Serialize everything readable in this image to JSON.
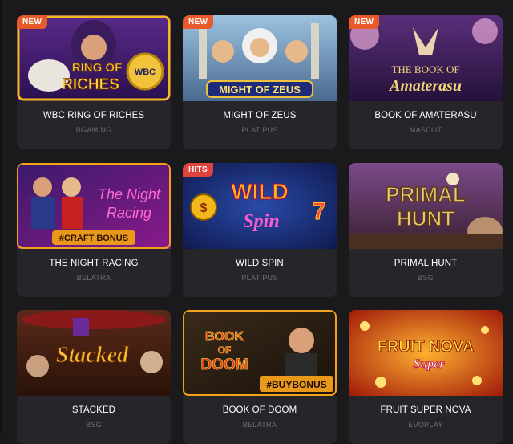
{
  "colors": {
    "background": "#1a1a1d",
    "card": "#26262a",
    "badge_new": "#e85a2a",
    "badge_hits": "#e0423c",
    "title": "#ffffff",
    "provider": "#6c6c73"
  },
  "games": [
    {
      "title": "WBC RING OF RICHES",
      "provider": "BGAMING",
      "badge": "NEW",
      "art_text": "RING OF RICHES"
    },
    {
      "title": "MIGHT OF ZEUS",
      "provider": "PLATIPUS",
      "badge": "NEW",
      "art_text": "MIGHT OF ZEUS"
    },
    {
      "title": "BOOK OF AMATERASU",
      "provider": "MASCOT",
      "badge": "NEW",
      "art_text": "THE BOOK OF Amaterasu"
    },
    {
      "title": "THE NIGHT RACING",
      "provider": "BELATRA",
      "badge": "",
      "art_text": "The Night Racing",
      "art_tag": "#CRAFT BONUS"
    },
    {
      "title": "WILD SPIN",
      "provider": "PLATIPUS",
      "badge": "HITS",
      "art_text": "WILD Spin"
    },
    {
      "title": "PRIMAL HUNT",
      "provider": "BSG",
      "badge": "",
      "art_text": "PRIMAL HUNT"
    },
    {
      "title": "STACKED",
      "provider": "BSG",
      "badge": "",
      "art_text": "Stacked"
    },
    {
      "title": "BOOK OF DOOM",
      "provider": "BELATRA",
      "badge": "",
      "art_text": "BOOK OF DOOM",
      "art_tag": "#BUYBONUS"
    },
    {
      "title": "FRUIT SUPER NOVA",
      "provider": "EVOPLAY",
      "badge": "",
      "art_text": "FRUIT NOVA Super"
    }
  ]
}
